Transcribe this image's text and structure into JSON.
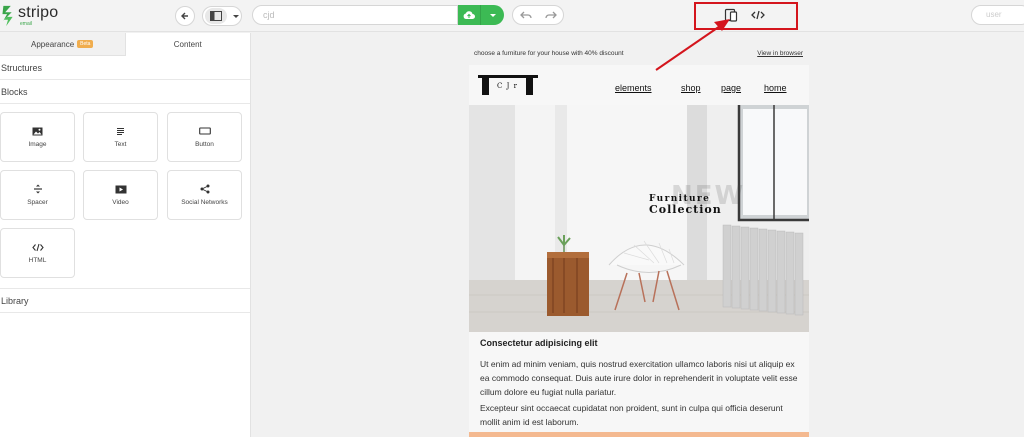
{
  "app": {
    "logo_name": "stripo",
    "logo_sub": "email",
    "url_value": "cjd",
    "user_label": "user"
  },
  "left_panel": {
    "tabs": [
      {
        "label": "Appearance",
        "badge": "Beta"
      },
      {
        "label": "Content"
      }
    ],
    "sections": {
      "structures": "Structures",
      "blocks": "Blocks",
      "library": "Library"
    },
    "blocks": [
      {
        "label": "Image",
        "icon": "image-icon"
      },
      {
        "label": "Text",
        "icon": "text-icon"
      },
      {
        "label": "Button",
        "icon": "button-icon"
      },
      {
        "label": "Spacer",
        "icon": "spacer-icon"
      },
      {
        "label": "Video",
        "icon": "video-icon"
      },
      {
        "label": "Social Networks",
        "icon": "share-icon"
      },
      {
        "label": "HTML",
        "icon": "code-icon"
      }
    ]
  },
  "email": {
    "preheader_text": "choose a furniture for your house with 40% discount",
    "view_in_browser": "View in browser",
    "logo_text": "C J r",
    "nav": [
      "elements",
      "shop",
      "page",
      "home"
    ],
    "hero_title_line1": "Furniture",
    "hero_title_line2": "Collection",
    "hero_watermark": "NEW",
    "heading": "Consectetur adipisicing elit",
    "paragraph1": "Ut enim ad minim veniam, quis nostrud exercitation ullamco laboris nisi ut aliquip ex ea commodo consequat. Duis aute irure dolor in reprehenderit in voluptate velit esse cillum dolore eu fugiat nulla pariatur.",
    "paragraph2": "Excepteur sint occaecat cupidatat non proident, sunt in culpa qui officia deserunt mollit anim id est laborum."
  },
  "colors": {
    "accent_green": "#3cba54",
    "highlight_red": "#d4151d",
    "badge_orange": "#f0ad4e"
  }
}
